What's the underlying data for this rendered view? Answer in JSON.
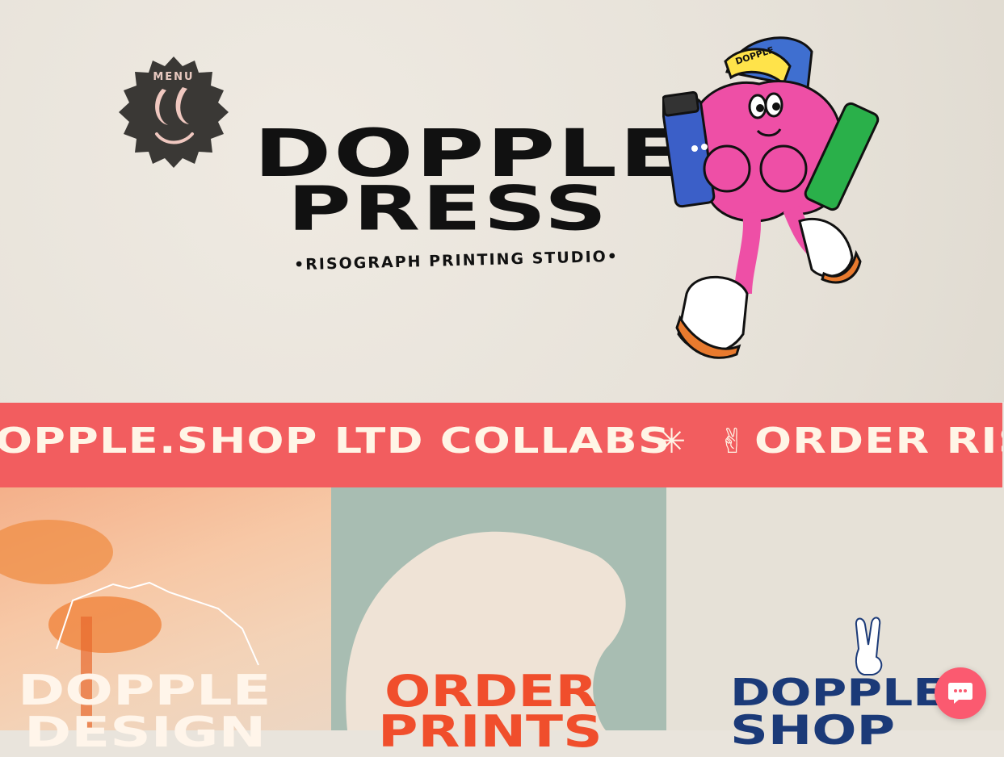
{
  "menu": {
    "label": "MENU"
  },
  "logo": {
    "line1": "DOPPLE",
    "line2": "PRESS",
    "tagline": "•RISOGRAPH PRINTING STUDIO•"
  },
  "mascot": {
    "cap_text": "DOPPLE"
  },
  "ticker": {
    "items": [
      "OPPLE.SHOP LTD COLLABS",
      "ORDER RISO PR"
    ],
    "separators": [
      "asterisk-icon",
      "peace-hand-icon"
    ]
  },
  "cards": [
    {
      "title_line1": "DOPPLE",
      "title_line2": "DESIGN"
    },
    {
      "title_line1": "ORDER",
      "title_line2": "PRINTS"
    },
    {
      "title_line1": "DOPPLE",
      "title_line2": "SHOP"
    }
  ],
  "chat": {
    "icon": "chat-bubble-icon"
  },
  "colors": {
    "background": "#e9e4dc",
    "ticker": "#f25d5f",
    "ticker_text": "#fff5e6",
    "card2_title": "#f04e2c",
    "card3_title": "#1b3a78",
    "chat_button": "#fb5a70",
    "menu_badge": "#3a3835"
  }
}
